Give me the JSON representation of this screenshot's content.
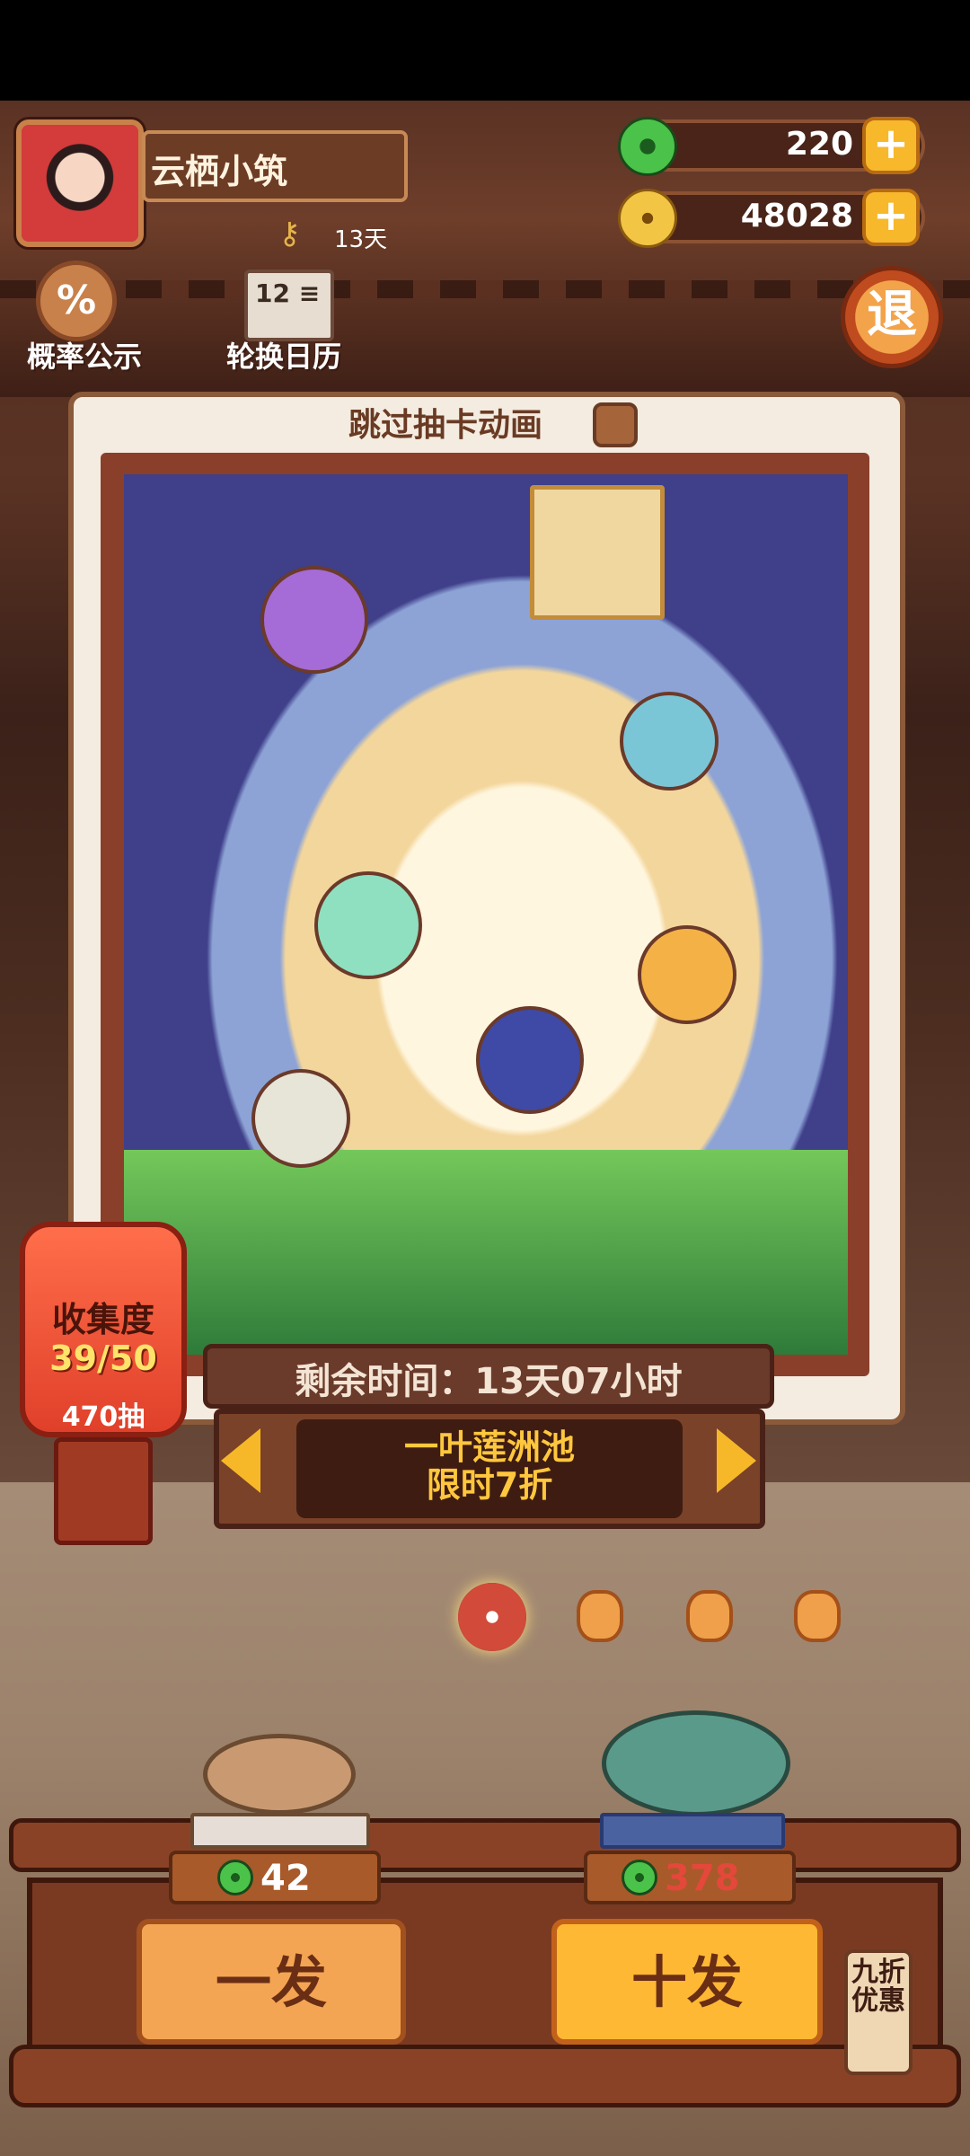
{
  "profile": {
    "name": "云栖小筑",
    "days": "13天"
  },
  "currency": {
    "jade": "220",
    "gold": "48028",
    "plus_symbol": "+"
  },
  "buttons": {
    "probability_icon": "%",
    "probability": "概率公示",
    "calendar_icon": "12",
    "calendar": "轮换日历",
    "exit": "退"
  },
  "card": {
    "skip_animation": "跳过抽卡动画"
  },
  "collection": {
    "title": "收集度",
    "count": "39/50",
    "draws": "470抽"
  },
  "pool": {
    "remaining_time": "剩余时间：13天07小时",
    "name": "一叶莲洲池",
    "sale": "限时7折"
  },
  "draw": {
    "single_cost": "42",
    "ten_cost": "378",
    "single_label": "一发",
    "ten_label": "十发",
    "discount_tag": "九折优惠"
  },
  "colors": {
    "accent_gold": "#ffb833",
    "cost_insufficient": "#e4483a",
    "jade_green": "#4bc24a"
  }
}
